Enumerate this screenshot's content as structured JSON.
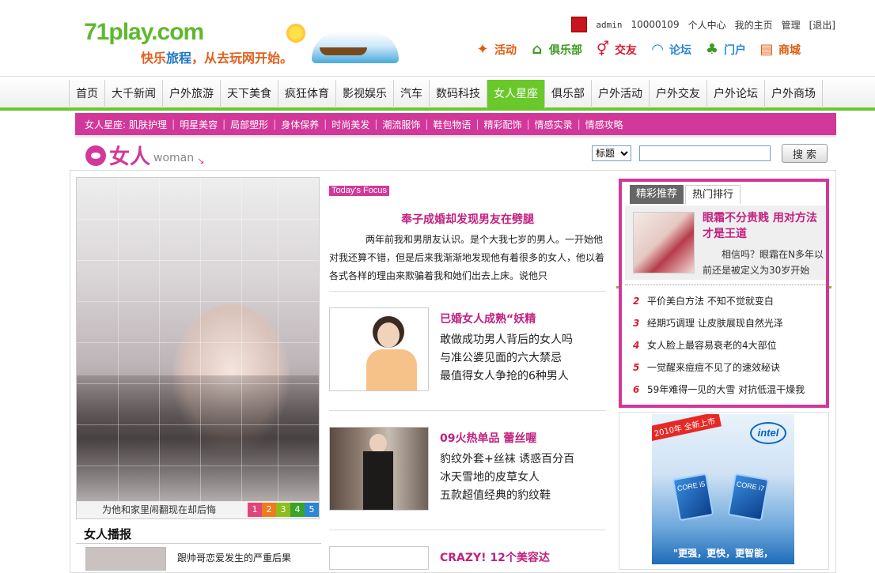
{
  "header": {
    "logo_text": "71play.com",
    "slogan_part1": "快乐",
    "slogan_part2": "旅程",
    "slogan_part3": "，从去玩网开始。"
  },
  "userbar": {
    "username": "admin",
    "user_id": "10000109",
    "links": [
      "个人中心",
      "我的主页",
      "管理",
      "[退出]"
    ]
  },
  "channels": [
    {
      "label": "活动",
      "icon": "activity-icon",
      "color": "#e05a0c"
    },
    {
      "label": "俱乐部",
      "icon": "house-icon",
      "color": "#3c9a1e"
    },
    {
      "label": "交友",
      "icon": "gender-icon",
      "color": "#d8182c"
    },
    {
      "label": "论坛",
      "icon": "rainbow-icon",
      "color": "#2b86d8"
    },
    {
      "label": "门户",
      "icon": "palm-tree-icon",
      "color": "#3c9a1e"
    },
    {
      "label": "商城",
      "icon": "cart-icon",
      "color": "#e05a0c"
    }
  ],
  "nav": {
    "items": [
      "首页",
      "大千新闻",
      "户外旅游",
      "天下美食",
      "疯狂体育",
      "影视娱乐",
      "汽车",
      "数码科技",
      "女人星座",
      "俱乐部",
      "户外活动",
      "户外交友",
      "户外论坛",
      "户外商场"
    ],
    "active_index": 8,
    "accent": "#6ac82a"
  },
  "subnav": {
    "prefix": "女人星座:",
    "items": [
      "肌肤护理",
      "明星美容",
      "局部塑形",
      "身体保养",
      "时尚美发",
      "潮流服饰",
      "鞋包物语",
      "精彩配饰",
      "情感实录",
      "情感攻略"
    ],
    "color": "#d2389a"
  },
  "section": {
    "title_cn": "女人",
    "title_en": "woman",
    "arrow": "↘"
  },
  "search": {
    "select_value": "标题",
    "input_value": "",
    "button_label": "搜 索"
  },
  "photo": {
    "caption": "为他和家里闹翻现在却后悔",
    "pager": [
      "1",
      "2",
      "3",
      "4",
      "5"
    ]
  },
  "broadcast": {
    "title": "女人播报",
    "first_item": "跟帅哥恋爱发生的严重后果"
  },
  "focus": {
    "tag": "Today's Focus",
    "headline": "奉子成婚却发现男友在劈腿",
    "body": "两年前我和男朋友认识。是个大我七岁的男人。一开始他对我还算不错，但是后来我渐渐地发现他有着很多的女人，他以着各式各样的理由来欺骗着我和她们出去上床。说他只"
  },
  "stories": [
    {
      "title": "已婚女人成熟“妖精",
      "lines": [
        "敢做成功男人背后的女人吗",
        "与准公婆见面的六大禁忌",
        "最值得女人争抢的6种男人"
      ]
    },
    {
      "title": "09火热单品  蕾丝喔",
      "lines": [
        "豹纹外套+丝袜 诱惑百分百",
        "冰天雪地的皮草女人",
        "五款超值经典的豹纹鞋"
      ]
    },
    {
      "title": "CRAZY! 12个美容达",
      "lines": []
    }
  ],
  "hot": {
    "tabs": [
      "精彩推荐",
      "热门排行"
    ],
    "active_tab": 1,
    "feature_title": "眼霜不分贵贱 用对方法才是王道",
    "feature_desc": "相信吗？眼霜在N多年以前还是被定义为30岁开始",
    "list": [
      {
        "num": "2",
        "text": "平价美白方法 不知不觉就变白"
      },
      {
        "num": "3",
        "text": "经期巧调理 让皮肤展现自然光泽"
      },
      {
        "num": "4",
        "text": "女人脸上最容易衰老的4大部位"
      },
      {
        "num": "5",
        "text": "一觉醒来痘痘不见了的速效秘诀"
      },
      {
        "num": "6",
        "text": "59年难得一见的大雪 对抗低温干燥我"
      }
    ]
  },
  "ad": {
    "badge": "2010年 全新上市",
    "brand": "intel",
    "chip_labels": [
      "CORE i5",
      "CORE i7"
    ],
    "slogan": "\"更强，更快，更智能，"
  }
}
